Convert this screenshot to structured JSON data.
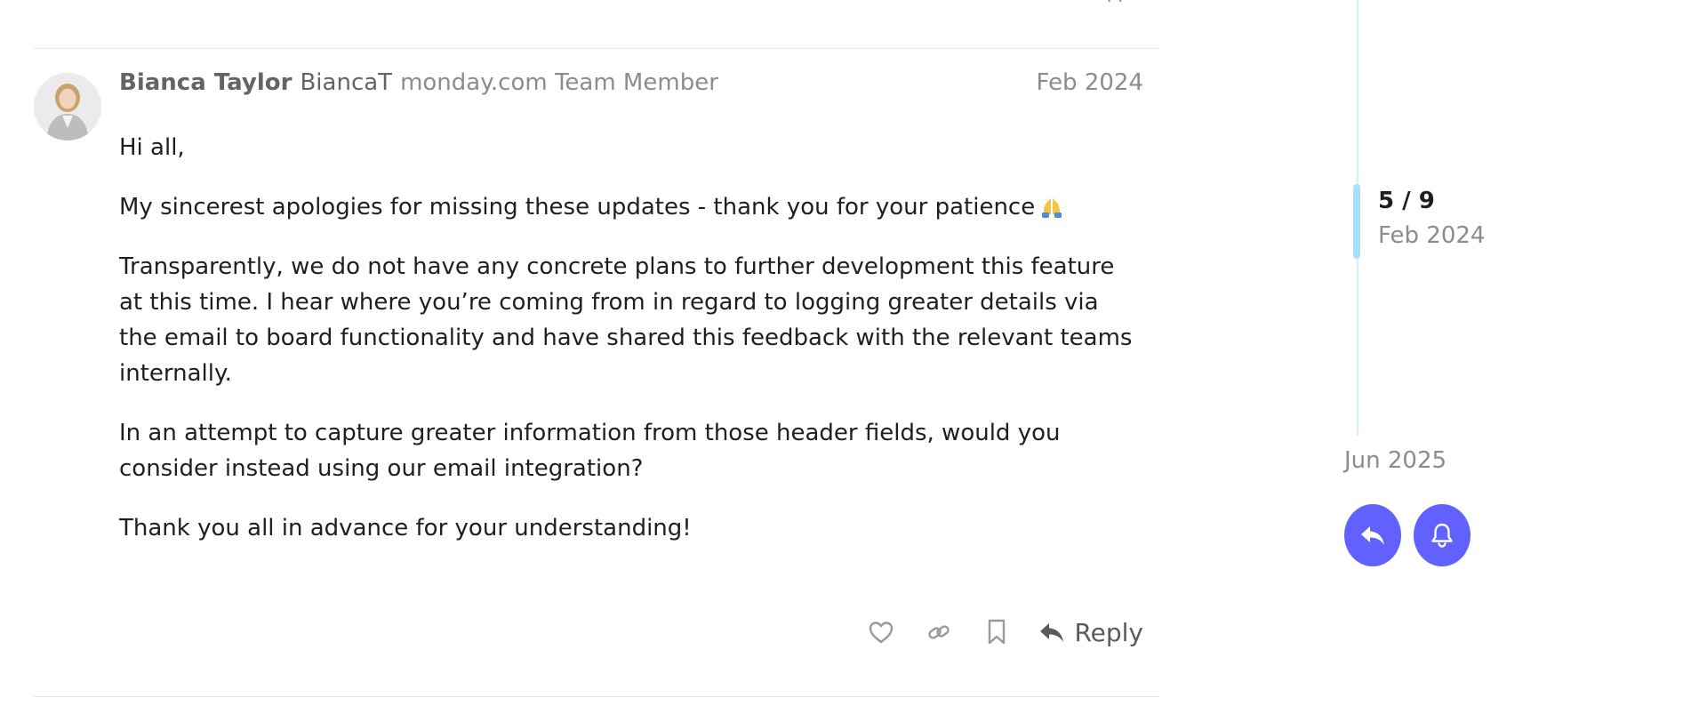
{
  "post": {
    "author_name": "Bianca Taylor",
    "author_username": "BiancaT",
    "author_title": "monday.com Team Member",
    "date": "Feb 2024",
    "paragraphs": {
      "p1": "Hi all,",
      "p2": "My sincerest apologies for missing these updates - thank you for your patience",
      "p3": "Transparently, we do not have any concrete plans to further development this feature at this time. I hear where you’re coming from in regard to logging greater details via the email to board functionality and have shared this feedback with the relevant teams internally.",
      "p4": "In an attempt to capture greater information from those header fields, would you consider instead using our email integration?",
      "p5": "Thank you all in advance for your understanding!"
    },
    "emoji_icon": "folded-hands-emoji",
    "actions": {
      "like_icon": "heart-icon",
      "link_icon": "link-icon",
      "bookmark_icon": "bookmark-icon",
      "reply_icon": "reply-arrow-icon",
      "reply_label": "Reply"
    }
  },
  "timeline": {
    "position": "5 / 9",
    "current_date": "Feb 2024",
    "end_date": "Jun 2025",
    "reply_button_icon": "reply-arrow-icon",
    "notify_button_icon": "bell-icon"
  },
  "colors": {
    "accent": "#6161ff",
    "timeline_track": "#d6f0fb",
    "timeline_handle": "#a6e0f9",
    "muted_text": "#8c8c8c",
    "author_text": "#646464",
    "body_text": "#1f1f1f"
  }
}
